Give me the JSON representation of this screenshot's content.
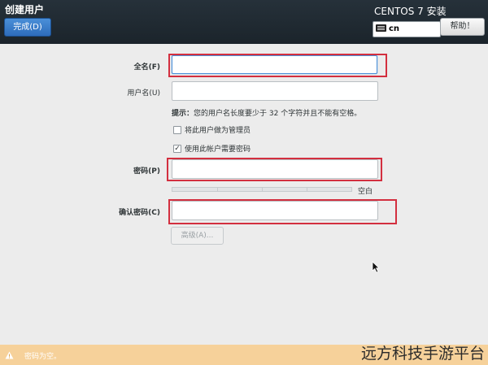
{
  "header": {
    "title": "创建用户",
    "done_label": "完成(D)",
    "product": "CENTOS 7 安装",
    "keyboard_layout": "cn",
    "help_label": "帮助！"
  },
  "form": {
    "fullname_label": "全名(F)",
    "fullname_value": "",
    "username_label": "用户名(U)",
    "username_value": "",
    "hint_prefix": "提示：",
    "hint_text": "您的用户名长度要少于 32 个字符并且不能有空格。",
    "admin_checkbox_label": "将此用户做为管理员",
    "admin_checked": false,
    "require_password_label": "使用此帐户需要密码",
    "require_password_checked": true,
    "password_label": "密码(P)",
    "password_value": "",
    "strength_label": "空白",
    "strength_fraction": 0,
    "confirm_label": "确认密码(C)",
    "confirm_value": "",
    "advanced_label": "高级(A)..."
  },
  "status": {
    "warning_text": "密码为空。"
  },
  "watermark": "远方科技手游平台",
  "colors": {
    "header_bg": "#1f2a32",
    "done_button": "#3b7dcc",
    "highlight_box": "#d32f3f",
    "warning_bar": "#f6d19a"
  }
}
